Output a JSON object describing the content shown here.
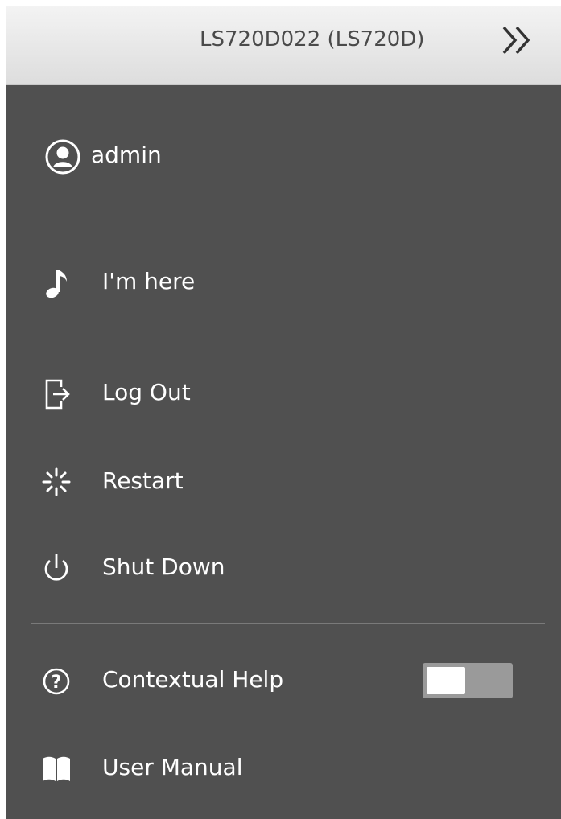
{
  "header": {
    "device_title": "LS720D022 (LS720D)",
    "collapse_icon": "double-chevron-right-icon"
  },
  "user": {
    "name": "admin",
    "icon": "user-avatar-icon"
  },
  "menu": {
    "im_here": {
      "label": "I'm here",
      "icon": "music-note-icon"
    },
    "log_out": {
      "label": "Log Out",
      "icon": "logout-icon"
    },
    "restart": {
      "label": "Restart",
      "icon": "restart-spinner-icon"
    },
    "shut_down": {
      "label": "Shut Down",
      "icon": "power-icon"
    },
    "contextual_help": {
      "label": "Contextual Help",
      "icon": "help-circle-icon",
      "enabled": false
    },
    "user_manual": {
      "label": "User Manual",
      "icon": "book-icon"
    }
  },
  "colors": {
    "panel_bg": "#505050",
    "header_bg": "#e8e8e8",
    "text": "#ffffff",
    "divider": "#7a7a7a",
    "toggle_track": "#9a9a9a",
    "toggle_knob": "#ffffff"
  }
}
